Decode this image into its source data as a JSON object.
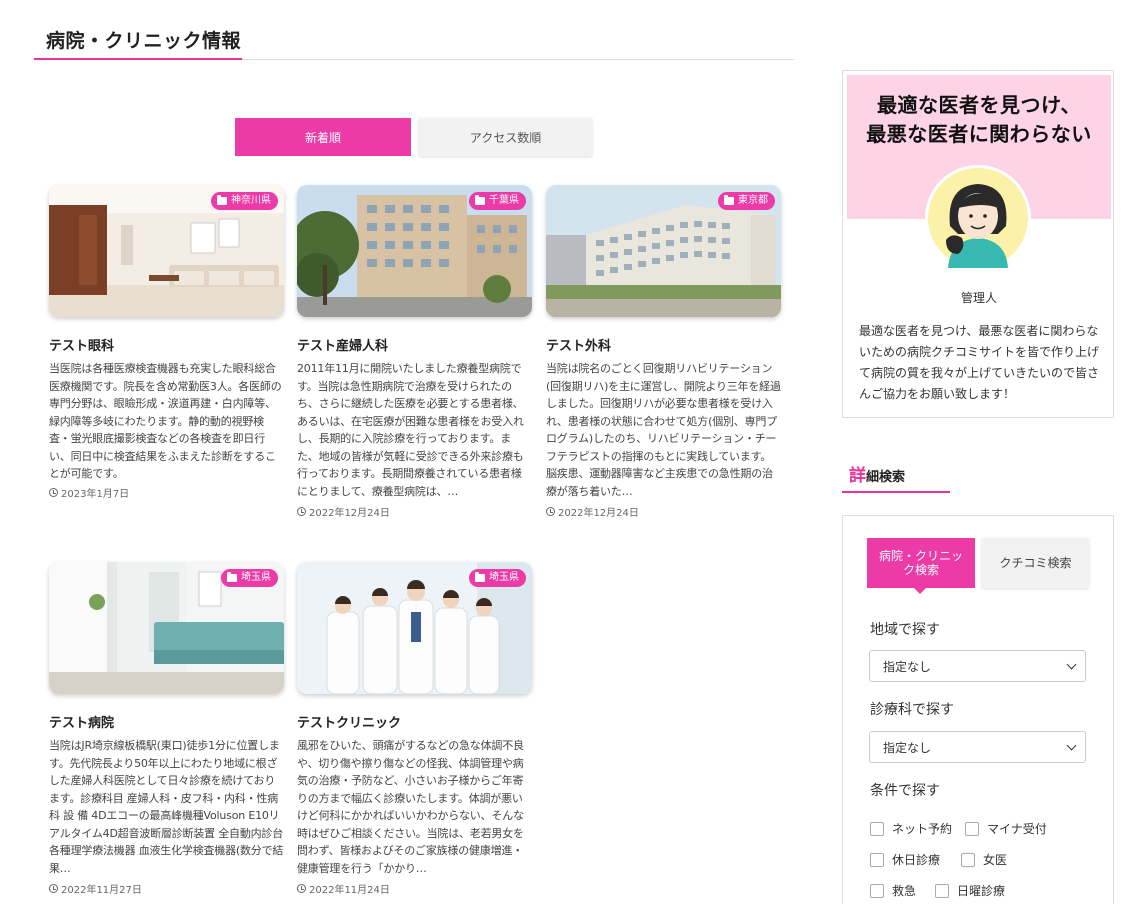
{
  "section": {
    "title": "病院・クリニック情報"
  },
  "sort_tabs": {
    "newest": "新着順",
    "access": "アクセス数順"
  },
  "cards": [
    {
      "title": "テスト眼科",
      "badge": "神奈川県",
      "desc": "当医院は各種医療検査機器も充実した眼科総合医療機関です。院長を含め常勤医3人。各医師の専門分野は、眼瞼形成・涙道再建・白内障等、緑内障等多岐にわたります。静的動的視野検査・蛍光眼底撮影検査などの各検査を即日行い、同日中に検査結果をふまえた診断をすることが可能です。",
      "date": "2023年1月7日"
    },
    {
      "title": "テスト産婦人科",
      "badge": "千葉県",
      "desc": "2011年11月に開院いたしました療養型病院です。当院は急性期病院で治療を受けられたのち、さらに継続した医療を必要とする患者様、あるいは、在宅医療が困難な患者様をお受入れし、長期的に入院診療を行っております。また、地域の皆様が気軽に受診できる外来診療も行っております。長期間療養されている患者様にとりまして、療養型病院は、…",
      "date": "2022年12月24日"
    },
    {
      "title": "テスト外科",
      "badge": "東京都",
      "desc": "当院は院名のごとく回復期リハビリテーション(回復期リハ)を主に運営し、開院より三年を経過しました。回復期リハが必要な患者様を受け入れ、患者様の状態に合わせて処方(個別、専門プログラム)したのち、リハビリテーション・チーフテラピストの指揮のもとに実践しています。脳疾患、運動器障害など主疾患での急性期の治療が落ち着いた…",
      "date": "2022年12月24日"
    },
    {
      "title": "テスト病院",
      "badge": "埼玉県",
      "desc": "当院はJR埼京線板橋駅(東口)徒歩1分に位置します。先代院長より50年以上にわたり地域に根ざした産婦人科医院として日々診療を続けております。診療科目 産婦人科・皮フ科・内科・性病科 設 備 4Dエコーの最高峰機種Voluson E10リアルタイム4D超音波断層診断装置 全自動内診台 各種理学療法機器 血液生化学検査機器(数分で結果…",
      "date": "2022年11月27日"
    },
    {
      "title": "テストクリニック",
      "badge": "埼玉県",
      "desc": "風邪をひいた、頭痛がするなどの急な体調不良や、切り傷や擦り傷などの怪我、体調管理や病気の治療・予防など、小さいお子様からご年寄りの方まで幅広く診療いたします。体調が悪いけど何科にかかればいいかわからない、そんな時はぜひご相談ください。当院は、老若男女を問わず、皆様およびそのご家族様の健康増進・健康管理を行う「かかり…",
      "date": "2022年11月24日"
    }
  ],
  "sidebar": {
    "banner": "最適な医者を見つけ、最悪な医者に関わらない",
    "banner_line1": "最適な医者を見つけ、",
    "banner_line2": "最悪な医者に関わらない",
    "avatar_name": "管理人",
    "desc": "最適な医者を見つけ、最悪な医者に関わらないための病院クチコミサイトを皆で作り上げて病院の質を我々が上げていきたいので皆さんご協力をお願い致します！",
    "search_heading_first": "詳",
    "search_heading_rest": "細検索",
    "search_tabs": {
      "clinic": "病院・クリニック検索",
      "review": "クチコミ検索"
    },
    "region_label": "地域で探す",
    "region_value": "指定なし",
    "dept_label": "診療科で探す",
    "dept_value": "指定なし",
    "cond_label": "条件で探す",
    "conditions": [
      "ネット予約",
      "マイナ受付",
      "休日診療",
      "女医",
      "救急",
      "日曜診療"
    ]
  },
  "colors": {
    "accent": "#ec3aa6",
    "banner_bg": "#fcd4e5"
  }
}
